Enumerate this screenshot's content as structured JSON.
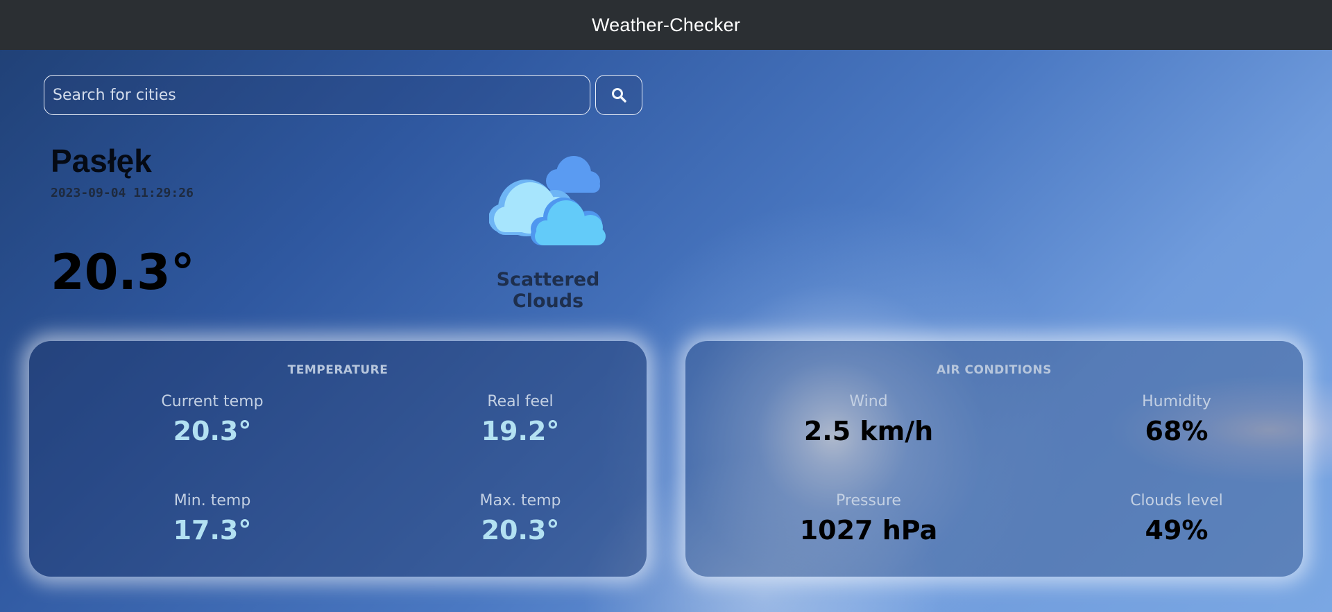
{
  "navbar": {
    "title": "Weather-Checker"
  },
  "search": {
    "placeholder": "Search for cities",
    "button_icon": "search-icon"
  },
  "current": {
    "city": "Pasłęk",
    "timestamp": "2023-09-04 11:29:26",
    "temperature": "20.3°",
    "condition": "Scattered Clouds",
    "condition_icon": "scattered-clouds-icon"
  },
  "temperature_card": {
    "title": "TEMPERATURE",
    "items": [
      {
        "label": "Current temp",
        "value": "20.3°"
      },
      {
        "label": "Real feel",
        "value": "19.2°"
      },
      {
        "label": "Min. temp",
        "value": "17.3°"
      },
      {
        "label": "Max. temp",
        "value": "20.3°"
      }
    ]
  },
  "air_card": {
    "title": "AIR CONDITIONS",
    "items": [
      {
        "label": "Wind",
        "value": "2.5 km/h"
      },
      {
        "label": "Humidity",
        "value": "68%"
      },
      {
        "label": "Pressure",
        "value": "1027 hPa"
      },
      {
        "label": "Clouds level",
        "value": "49%"
      }
    ]
  },
  "colors": {
    "navbar_bg": "#2b2f33",
    "temp_value": "#b3e1f2",
    "air_value": "#000000",
    "sky_blue": "#4a78c2"
  }
}
